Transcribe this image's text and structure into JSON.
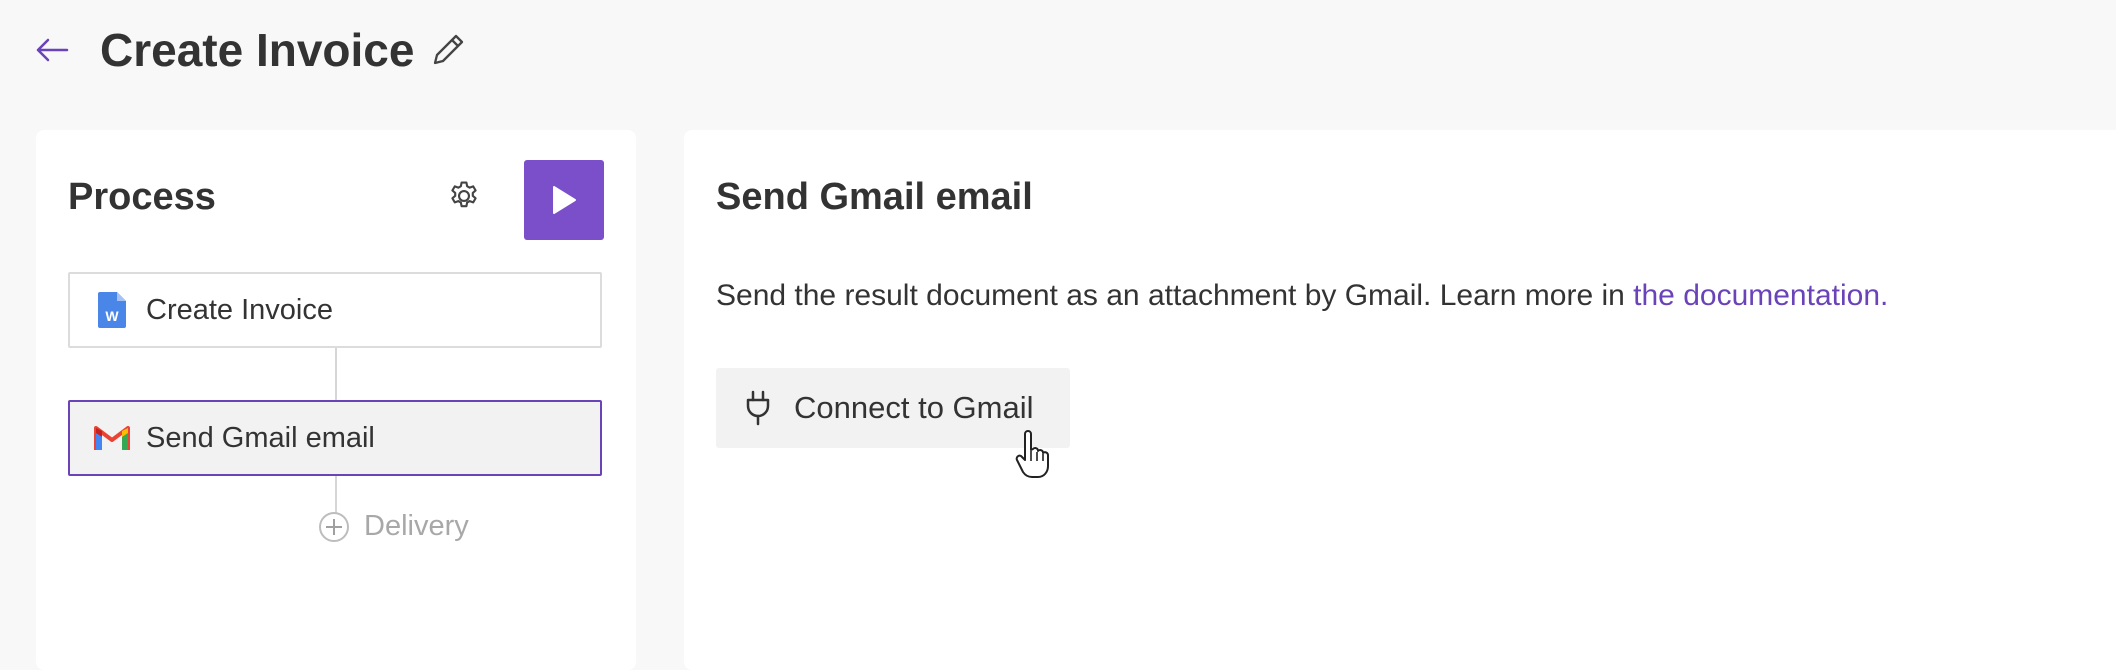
{
  "header": {
    "title": "Create Invoice",
    "icons": {
      "back": "arrow-left-icon",
      "edit": "pencil-icon"
    },
    "accent": "#6a43b8"
  },
  "process_panel": {
    "title": "Process",
    "icons": {
      "settings": "gear-icon",
      "run": "play-icon"
    },
    "run_button_color": "#7b4fc9",
    "steps": [
      {
        "label": "Create Invoice",
        "icon": "google-docs-icon",
        "selected": false
      },
      {
        "label": "Send Gmail email",
        "icon": "gmail-icon",
        "selected": true
      }
    ],
    "add_delivery": {
      "label": "Delivery",
      "icon": "plus-circle-icon"
    }
  },
  "detail_panel": {
    "title": "Send Gmail email",
    "description": "Send the result document as an attachment by Gmail. Learn more in ",
    "link_text": "the documentation.",
    "connect_button": {
      "label": "Connect to Gmail",
      "icon": "plug-icon"
    }
  }
}
